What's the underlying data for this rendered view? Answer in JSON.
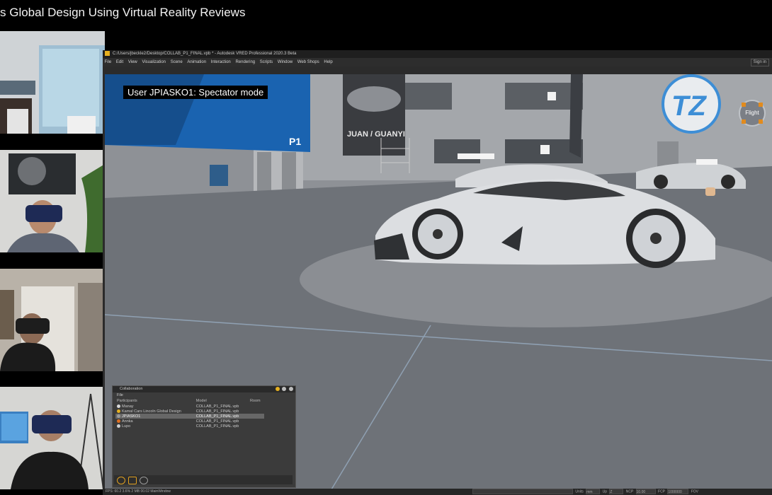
{
  "headline": "s Global Design Using Virtual Reality Reviews",
  "window": {
    "title": "C:/Users/jbeckle2/Desktop/COLLAB_P1_FINAL.vpb * - Autodesk VRED Professional 2020.3 Beta",
    "signin": "Sign in"
  },
  "menu": [
    "File",
    "Edit",
    "View",
    "Visualization",
    "Scene",
    "Animation",
    "Interaction",
    "Rendering",
    "Scripts",
    "Window",
    "Web Shops",
    "Help"
  ],
  "viewport": {
    "user_label": "User JPIASKO1: Spectator mode",
    "flight_button": "Flight",
    "signs": {
      "juan": "JUAN / GUANYI",
      "tz_logo": "TZ",
      "p1": "P1"
    }
  },
  "collaboration": {
    "title": "Collaboration",
    "menu": "File",
    "columns": [
      "Participants",
      "Model",
      "Room"
    ],
    "rows": [
      {
        "name": "Manay",
        "model": "COLLAB_P1_FINAL.vpb",
        "color": "#d9d9d9",
        "selected": false
      },
      {
        "name": "Kamal Cars Lincoln Global Design",
        "model": "COLLAB_P1_FINAL.vpb",
        "color": "#e6b020",
        "selected": false
      },
      {
        "name": "JPIASKO1",
        "model": "COLLAB_P1_FINAL.vpb",
        "color": "#9a9a9a",
        "selected": true
      },
      {
        "name": "Annka",
        "model": "COLLAB_P1_FINAL.vpb",
        "color": "#e07020",
        "selected": false
      },
      {
        "name": "Lupo",
        "model": "COLLAB_P1_FINAL.vpb",
        "color": "#cfcfcf",
        "selected": false
      }
    ]
  },
  "statusbar": {
    "left": "FPS: 60.2  3.6%  2 MB  00.02  MainWindow",
    "units": "Units",
    "units_value": "mm",
    "up": "Up",
    "up_value": "Z",
    "ncp": "NCP",
    "ncp_value": "10.00",
    "fcp": "FCP",
    "fcp_value": "1000000",
    "fov": "FOV"
  },
  "colors": {
    "accent": "#e6b020",
    "banner_blue": "#1a63b0",
    "floor": "#6e7278",
    "platform": "#8b8e93"
  }
}
